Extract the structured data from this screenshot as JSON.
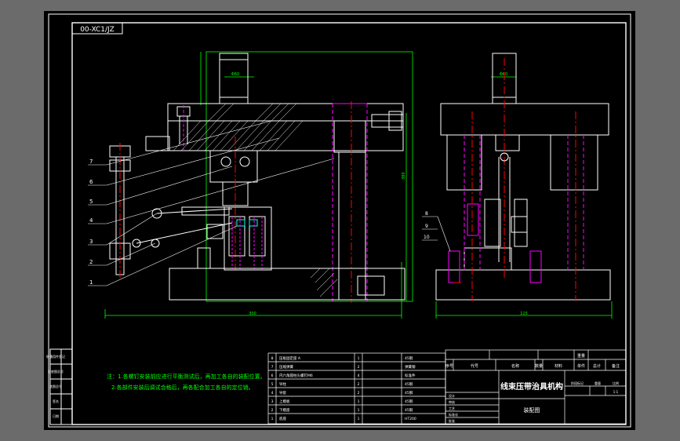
{
  "drawing_code": "00-XC1/JZ",
  "title": "线束压带治具机构",
  "subtitle": "装配图",
  "technical_notes": [
    "注：1.各螺钉安装前应进行平衡测试后，再加工各自的装配位置。",
    "2.各部件安装后调试合格后，再各配合加工各自的定位销。"
  ],
  "balloons": [
    "7",
    "6",
    "5",
    "4",
    "3",
    "2",
    "1"
  ],
  "side_balloons": [
    "8",
    "9",
    "10"
  ],
  "dimensions": {
    "front_width": "300",
    "front_height": "380",
    "side_width": "115",
    "cylinder_width": "Φ60",
    "side_cylinder_width": "Φ60"
  },
  "bom_rows": [
    [
      "8",
      "压板固定座 A",
      "1",
      "45钢"
    ],
    [
      "7",
      "压缩弹簧",
      "2",
      "弹簧钢"
    ],
    [
      "6",
      "内六角圆柱头螺钉M6",
      "4",
      "标准件"
    ],
    [
      "5",
      "导柱",
      "2",
      "45钢"
    ],
    [
      "4",
      "导套",
      "2",
      "45钢"
    ],
    [
      "3",
      "上模板",
      "1",
      "45钢"
    ],
    [
      "2",
      "下模座",
      "1",
      "45钢"
    ],
    [
      "1",
      "底座",
      "1",
      "HT200"
    ]
  ],
  "title_block": {
    "header_cells": [
      "序号",
      "代号",
      "名称",
      "数量",
      "材料",
      "单件",
      "总计",
      "重量",
      "备注"
    ],
    "small_labels": [
      "设计",
      "审核",
      "工艺",
      "标准化",
      "批准"
    ],
    "scale_labels": [
      "阶段标记",
      "重量",
      "比例"
    ],
    "scale_value": "1:1"
  },
  "left_strip": [
    "借通用件登记",
    "旧底图总号",
    "底图总号",
    "签名",
    "日期"
  ],
  "colors": {
    "background": "#000000",
    "frame": "#ffffff",
    "outline": "#ffffff",
    "hidden": "#ff00ff",
    "center": "#ff0000",
    "dimension": "#00ff00",
    "leader": "#ffffff",
    "notes": "#00ff00",
    "hatch": "#ffffff"
  }
}
